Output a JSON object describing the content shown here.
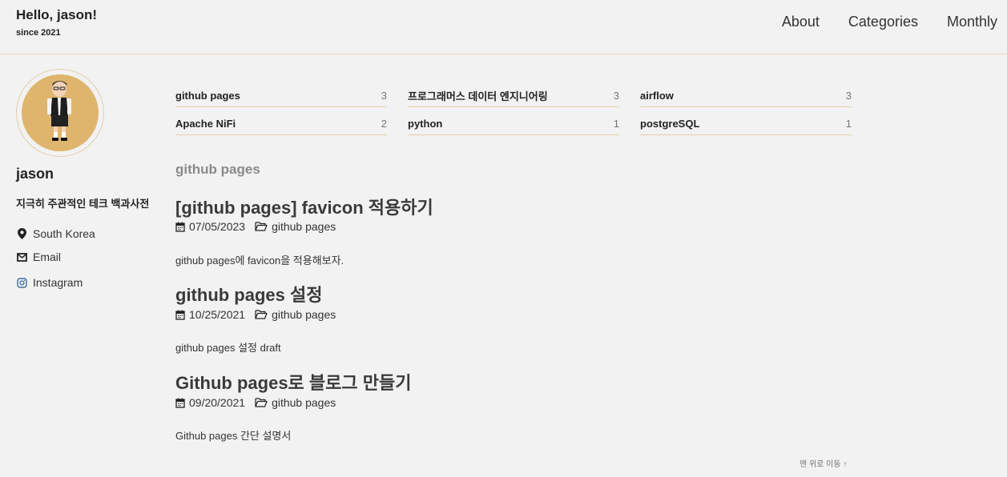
{
  "header": {
    "title": "Hello, jason!",
    "subtitle": "since 2021",
    "nav": [
      "About",
      "Categories",
      "Monthly"
    ]
  },
  "author": {
    "name": "jason",
    "bio": "지극히 주관적인 테크 백과사전",
    "links": [
      {
        "label": "South Korea",
        "icon": "map-marker-icon"
      },
      {
        "label": "Email",
        "icon": "envelope-icon"
      },
      {
        "label": "Instagram",
        "icon": "instagram-icon"
      }
    ]
  },
  "categories": [
    {
      "name": "github pages",
      "count": "3"
    },
    {
      "name": "프로그래머스 데이터 엔지니어링",
      "count": "3"
    },
    {
      "name": "airflow",
      "count": "3"
    },
    {
      "name": "Apache NiFi",
      "count": "2"
    },
    {
      "name": "python",
      "count": "1"
    },
    {
      "name": "postgreSQL",
      "count": "1"
    }
  ],
  "section_title": "github pages",
  "posts": [
    {
      "title": "[github pages] favicon 적용하기",
      "date": "07/05/2023",
      "category": "github pages",
      "excerpt": "github pages에 favicon을 적용해보자."
    },
    {
      "title": "github pages 설정",
      "date": "10/25/2021",
      "category": "github pages",
      "excerpt": "github pages 설정 draft"
    },
    {
      "title": "Github pages로 블로그 만들기",
      "date": "09/20/2021",
      "category": "github pages",
      "excerpt": "Github pages 간단 설명서"
    }
  ],
  "back_to_top": "맨 위로 이동 ↑",
  "colors": {
    "background": "#f2f2f2",
    "divider": "#e3cfae",
    "avatar_bg": "#dfb56d",
    "section_title": "#8a8a8a"
  }
}
